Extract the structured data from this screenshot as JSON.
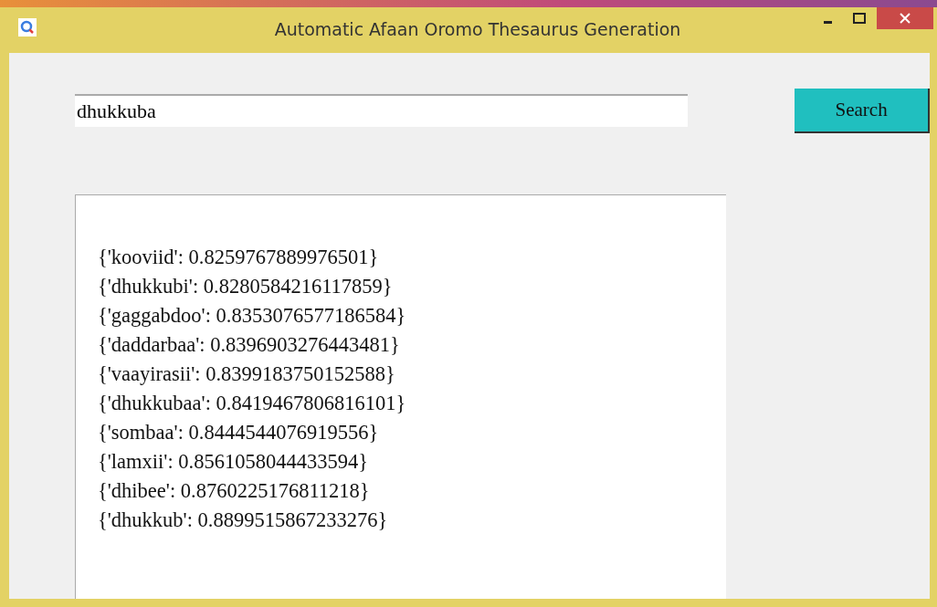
{
  "window": {
    "title": "Automatic Afaan Oromo Thesaurus Generation"
  },
  "search": {
    "value": "dhukkuba"
  },
  "search_button": {
    "label": "Search"
  },
  "results": [
    "{'kooviid': 0.8259767889976501}",
    "{'dhukkubi': 0.8280584216117859}",
    "{'gaggabdoo': 0.8353076577186584}",
    "{'daddarbaa': 0.8396903276443481}",
    "{'vaayirasii': 0.8399183750152588}",
    "{'dhukkubaa': 0.8419467806816101}",
    "{'sombaa': 0.8444544076919556}",
    "{'lamxii': 0.8561058044433594}",
    "{'dhibee': 0.8760225176811218}",
    "{'dhukkub': 0.8899515867233276}"
  ]
}
